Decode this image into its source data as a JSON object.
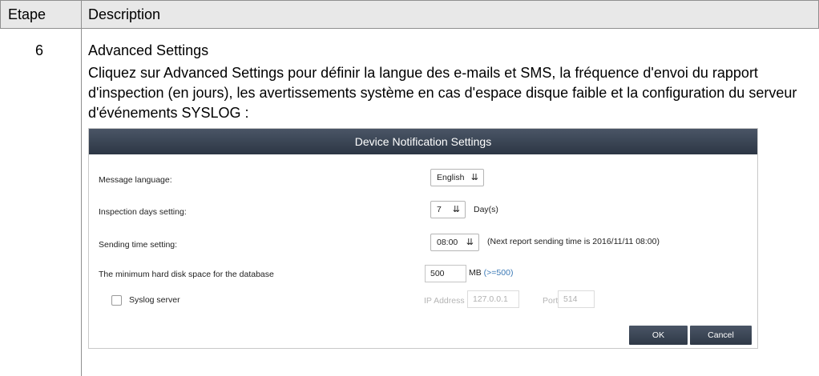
{
  "table": {
    "header": {
      "col1": "Etape",
      "col2": "Description"
    },
    "row": {
      "step": "6",
      "title": "Advanced Settings",
      "text_parts": [
        "Cliquez sur ",
        "Advanced Settings",
        " pour définir la langue des e-mails et SMS, la fréquence d'envoi du rapport d'inspection (en jours), les avertissements système en cas d'espace disque faible et la configuration du serveur d'événements SYSLOG :"
      ]
    }
  },
  "dialog": {
    "title": "Device Notification Settings",
    "message_language": {
      "label": "Message language:",
      "value": "English"
    },
    "inspection_days": {
      "label": "Inspection days setting:",
      "value": "7",
      "unit": "Day(s)"
    },
    "sending_time": {
      "label": "Sending time setting:",
      "value": "08:00",
      "note": "(Next report sending time is 2016/11/11 08:00)"
    },
    "min_disk": {
      "label": "The minimum hard disk space for the database",
      "value": "500",
      "unit": "MB",
      "hint": "(>=500)"
    },
    "syslog": {
      "label": "Syslog server",
      "checked": false,
      "ip_label": "IP Address",
      "ip_value": "127.0.0.1",
      "port_label": "Port",
      "port_value": "514"
    },
    "buttons": {
      "ok": "OK",
      "cancel": "Cancel"
    }
  },
  "colors": {
    "dialog_header": "#2c3644",
    "hint_blue": "#3a78b5",
    "table_header": "#e8e8e8"
  },
  "icons": {
    "dropdown": "double-chevron-down-icon"
  }
}
